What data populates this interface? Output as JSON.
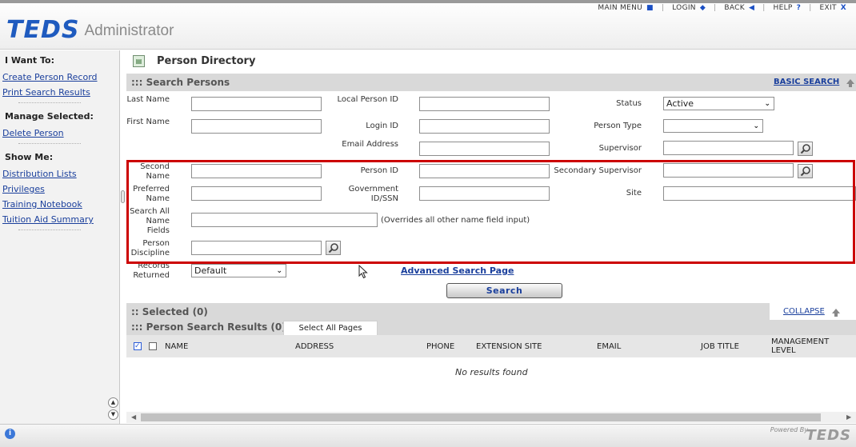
{
  "topnav": {
    "main_menu": "MAIN MENU",
    "login": "LOGIN",
    "back": "BACK",
    "help": "HELP",
    "exit": "EXIT"
  },
  "brand": {
    "logo": "TEDS",
    "subtitle": "Administrator"
  },
  "sidebar": {
    "i_want_to": {
      "heading": "I Want To:",
      "links": [
        "Create Person Record",
        "Print Search Results"
      ]
    },
    "manage_selected": {
      "heading": "Manage Selected:",
      "links": [
        "Delete Person"
      ]
    },
    "show_me": {
      "heading": "Show Me:",
      "links": [
        "Distribution Lists",
        "Privileges",
        "Training Notebook",
        "Tuition Aid Summary"
      ]
    }
  },
  "page": {
    "title": "Person Directory"
  },
  "search_section": {
    "heading": "::: Search Persons",
    "basic_search_link": "BASIC SEARCH"
  },
  "fields": {
    "last_name": {
      "label": "Last Name",
      "value": ""
    },
    "first_name": {
      "label": "First Name",
      "value": ""
    },
    "second_name": {
      "label": "Second Name",
      "value": ""
    },
    "preferred_name": {
      "label": "Preferred Name",
      "value": ""
    },
    "search_all_names": {
      "label": "Search All Name Fields",
      "value": "",
      "note": "(Overrides all other name field input)"
    },
    "person_discipline": {
      "label": "Person Discipline",
      "value": ""
    },
    "records_returned": {
      "label": "Records Returned",
      "value": "Default"
    },
    "local_person_id": {
      "label": "Local Person ID",
      "value": ""
    },
    "login_id": {
      "label": "Login ID",
      "value": ""
    },
    "email_address": {
      "label": "Email Address",
      "value": ""
    },
    "person_id": {
      "label": "Person ID",
      "value": ""
    },
    "government_id": {
      "label": "Government ID/SSN",
      "value": ""
    },
    "status": {
      "label": "Status",
      "value": "Active"
    },
    "person_type": {
      "label": "Person Type",
      "value": ""
    },
    "supervisor": {
      "label": "Supervisor",
      "value": ""
    },
    "secondary_supervisor": {
      "label": "Secondary Supervisor",
      "value": ""
    },
    "site": {
      "label": "Site",
      "value": ""
    }
  },
  "actions": {
    "advanced_search": "Advanced Search Page",
    "search_button": "Search"
  },
  "selected_section": {
    "heading": ":: Selected (0)",
    "collapse_link": "COLLAPSE"
  },
  "results": {
    "heading": "::: Person Search Results (0)",
    "select_all_tab": "Select All Pages",
    "columns": [
      "NAME",
      "ADDRESS",
      "PHONE",
      "EXTENSION SITE",
      "EMAIL",
      "JOB TITLE",
      "MANAGEMENT LEVEL"
    ],
    "empty_message": "No results found"
  },
  "footer": {
    "powered_by": "Powered By",
    "logo": "TEDS"
  }
}
